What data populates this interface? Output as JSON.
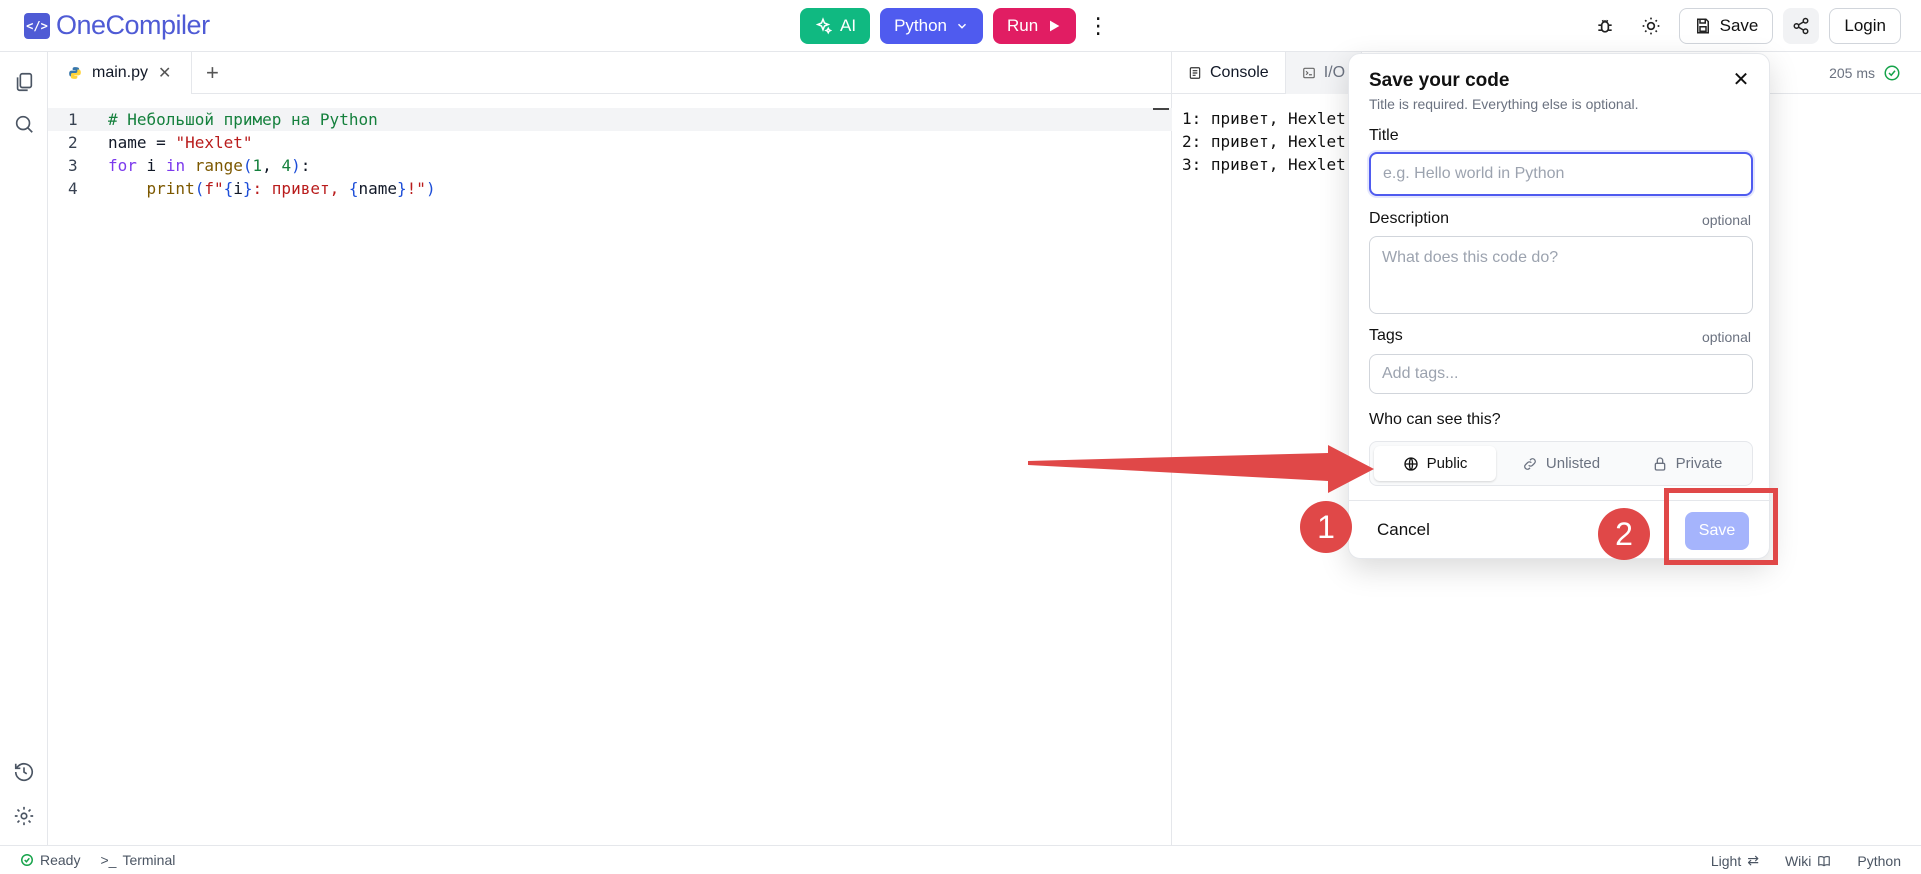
{
  "header": {
    "logo_mark": "</>",
    "logo_text": "OneCompiler",
    "ai_label": "AI",
    "language_label": "Python",
    "run_label": "Run",
    "save_label": "Save",
    "login_label": "Login"
  },
  "editor": {
    "tab_name": "main.py",
    "lines": [
      {
        "num": "1"
      },
      {
        "num": "2"
      },
      {
        "num": "3"
      },
      {
        "num": "4"
      }
    ],
    "code": {
      "l1": "# Небольшой пример на Python",
      "l2_a": "name = ",
      "l2_b": "\"Hexlet\"",
      "l3_a": "for",
      "l3_b": " i ",
      "l3_c": "in",
      "l3_d": " ",
      "l3_e": "range",
      "l3_f": "(",
      "l3_g": "1",
      "l3_h": ", ",
      "l3_i": "4",
      "l3_j": ")",
      "l3_k": ":",
      "l4_a": "    ",
      "l4_b": "print",
      "l4_c": "(",
      "l4_d": "f\"",
      "l4_e": "{",
      "l4_f": "i",
      "l4_g": "}",
      "l4_h": ": привет, ",
      "l4_i": "{",
      "l4_j": "name",
      "l4_k": "}",
      "l4_l": "!\"",
      "l4_m": ")"
    }
  },
  "right_pane": {
    "console_tab": "Console",
    "io_tab": "I/O",
    "timing": "205 ms",
    "output": [
      "1: привет, Hexlet",
      "2: привет, Hexlet",
      "3: привет, Hexlet"
    ]
  },
  "modal": {
    "title": "Save your code",
    "subtitle": "Title is required. Everything else is optional.",
    "title_label": "Title",
    "title_placeholder": "e.g. Hello world in Python",
    "description_label": "Description",
    "description_placeholder": "What does this code do?",
    "optional": "optional",
    "tags_label": "Tags",
    "tags_placeholder": "Add tags...",
    "visibility_label": "Who can see this?",
    "visibility_options": [
      "Public",
      "Unlisted",
      "Private"
    ],
    "cancel_label": "Cancel",
    "save_label": "Save"
  },
  "annotations": {
    "badge1": "1",
    "badge2": "2",
    "color": "#e04848"
  },
  "status_bar": {
    "ready": "Ready",
    "terminal": "Terminal",
    "theme": "Light",
    "wiki": "Wiki",
    "language": "Python"
  }
}
